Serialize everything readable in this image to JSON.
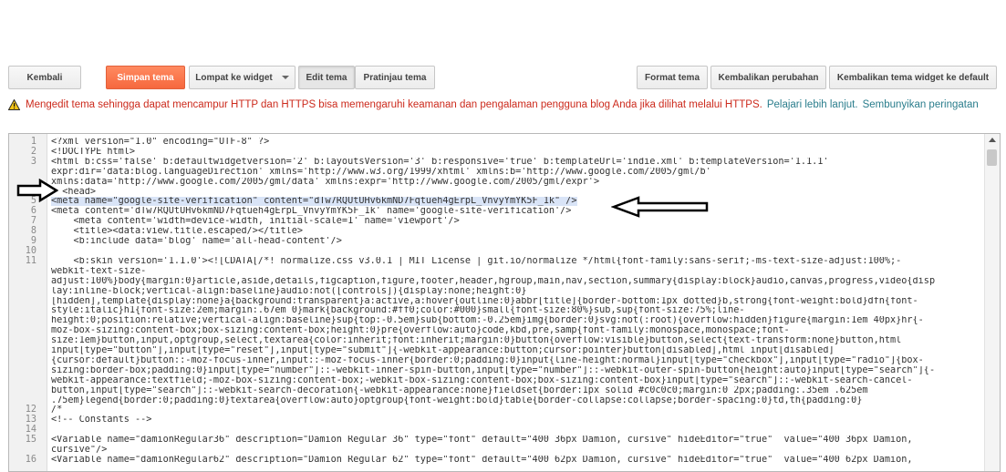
{
  "toolbar": {
    "back": "Kembali",
    "save": "Simpan tema",
    "jump": "Lompat ke widget",
    "edit": "Edit tema",
    "preview": "Pratinjau tema",
    "format": "Format tema",
    "revert": "Kembalikan perubahan",
    "revert_widgets": "Kembalikan tema widget ke default"
  },
  "warning": {
    "icon": "warning-icon",
    "message": "Mengedit tema sehingga dapat mencampur HTTP dan HTTPS bisa memengaruhi keamanan dan pengalaman pengguna blog Anda jika dilihat melalui HTTPS.",
    "learn_more": "Pelajari lebih lanjut.",
    "hide": "Sembunyikan peringatan"
  },
  "colors": {
    "primary": "#f6683e",
    "warning_text": "#cc2a1c",
    "link": "#2a7d8c",
    "highlight": "#d9e4f7"
  },
  "editor": {
    "lines": [
      {
        "n": "1",
        "t": "<?xml version=\"1.0\" encoding=\"UTF-8\" ?>"
      },
      {
        "n": "2",
        "t": "<!DOCTYPE html>"
      },
      {
        "n": "3",
        "t": "<html b:css='false' b:defaultwidgetversion='2' b:layoutsVersion='3' b:responsive='true' b:templateUrl='indie.xml' b:templateVersion='1.1.1'"
      },
      {
        "n": "",
        "t": "expr:dir='data:blog.languageDirection' xmlns='http://www.w3.org/1999/xhtml' xmlns:b='http://www.google.com/2005/gml/b'"
      },
      {
        "n": "",
        "t": "xmlns:data='http://www.google.com/2005/gml/data' xmlns:expr='http://www.google.com/2005/gml/expr'>"
      },
      {
        "n": "4",
        "t": "  <head>"
      },
      {
        "n": "5",
        "t": "<meta name=\"google-site-verification\" content=\"dTw7RQUtUHv6kmND7Fqtueh4gErpL_VnvyYmYK5F_1k\" />",
        "hl": true
      },
      {
        "n": "6",
        "t": "<meta content='dTw7RQUtUHv6kmND7Fqtueh4gErpL_VnvyYmYK5F_1k' name='google-site-verification'/>"
      },
      {
        "n": "7",
        "t": "    <meta content='width=device-width, initial-scale=1' name='viewport'/>"
      },
      {
        "n": "8",
        "t": "    <title><data:view.title.escaped/></title>"
      },
      {
        "n": "9",
        "t": "    <b:include data='blog' name='all-head-content'/>"
      },
      {
        "n": "10",
        "t": ""
      },
      {
        "n": "11",
        "t": "    <b:skin version='1.1.0'><![CDATA[/*! normalize.css v3.0.1 | MIT License | git.io/normalize */html{font-family:sans-serif;-ms-text-size-adjust:100%;-"
      },
      {
        "n": "",
        "t": "webkit-text-size-"
      },
      {
        "n": "",
        "t": "adjust:100%}body{margin:0}article,aside,details,figcaption,figure,footer,header,hgroup,main,nav,section,summary{display:block}audio,canvas,progress,video{disp"
      },
      {
        "n": "",
        "t": "lay:inline-block;vertical-align:baseline}audio:not([controls]){display:none;height:0}"
      },
      {
        "n": "",
        "t": "[hidden],template{display:none}a{background:transparent}a:active,a:hover{outline:0}abbr[title]{border-bottom:1px dotted}b,strong{font-weight:bold}dfn{font-"
      },
      {
        "n": "",
        "t": "style:italic}h1{font-size:2em;margin:.67em 0}mark{background:#ff0;color:#000}small{font-size:80%}sub,sup{font-size:75%;line-"
      },
      {
        "n": "",
        "t": "height:0;position:relative;vertical-align:baseline}sup{top:-0.5em}sub{bottom:-0.25em}img{border:0}svg:not(:root){overflow:hidden}figure{margin:1em 40px}hr{-"
      },
      {
        "n": "",
        "t": "moz-box-sizing:content-box;box-sizing:content-box;height:0}pre{overflow:auto}code,kbd,pre,samp{font-family:monospace,monospace;font-"
      },
      {
        "n": "",
        "t": "size:1em}button,input,optgroup,select,textarea{color:inherit;font:inherit;margin:0}button{overflow:visible}button,select{text-transform:none}button,html"
      },
      {
        "n": "",
        "t": "input[type=\"button\"],input[type=\"reset\"],input[type=\"submit\"]{-webkit-appearance:button;cursor:pointer}button[disabled],html input[disabled]"
      },
      {
        "n": "",
        "t": "{cursor:default}button::-moz-focus-inner,input::-moz-focus-inner{border:0;padding:0}input{line-height:normal}input[type=\"checkbox\"],input[type=\"radio\"]{box-"
      },
      {
        "n": "",
        "t": "sizing:border-box;padding:0}input[type=\"number\"]::-webkit-inner-spin-button,input[type=\"number\"]::-webkit-outer-spin-button{height:auto}input[type=\"search\"]{-"
      },
      {
        "n": "",
        "t": "webkit-appearance:textfield;-moz-box-sizing:content-box;-webkit-box-sizing:content-box;box-sizing:content-box}input[type=\"search\"]::-webkit-search-cancel-"
      },
      {
        "n": "",
        "t": "button,input[type=\"search\"]::-webkit-search-decoration{-webkit-appearance:none}fieldset{border:1px solid #c0c0c0;margin:0 2px;padding:.35em .625em"
      },
      {
        "n": "",
        "t": ".75em}legend{border:0;padding:0}textarea{overflow:auto}optgroup{font-weight:bold}table{border-collapse:collapse;border-spacing:0}td,th{padding:0}"
      },
      {
        "n": "12",
        "t": "/*"
      },
      {
        "n": "13",
        "t": "<!-- Constants -->"
      },
      {
        "n": "14",
        "t": ""
      },
      {
        "n": "15",
        "t": "<Variable name=\"damionRegular36\" description=\"Damion Regular 36\" type=\"font\" default=\"400 36px Damion, cursive\" hideEditor=\"true\"  value=\"400 36px Damion,"
      },
      {
        "n": "",
        "t": "cursive\"/>"
      },
      {
        "n": "16",
        "t": "<Variable name=\"damionRegular62\" description=\"Damion Regular 62\" type=\"font\" default=\"400 62px Damion, cursive\" hideEditor=\"true\"  value=\"400 62px Damion,"
      }
    ]
  }
}
